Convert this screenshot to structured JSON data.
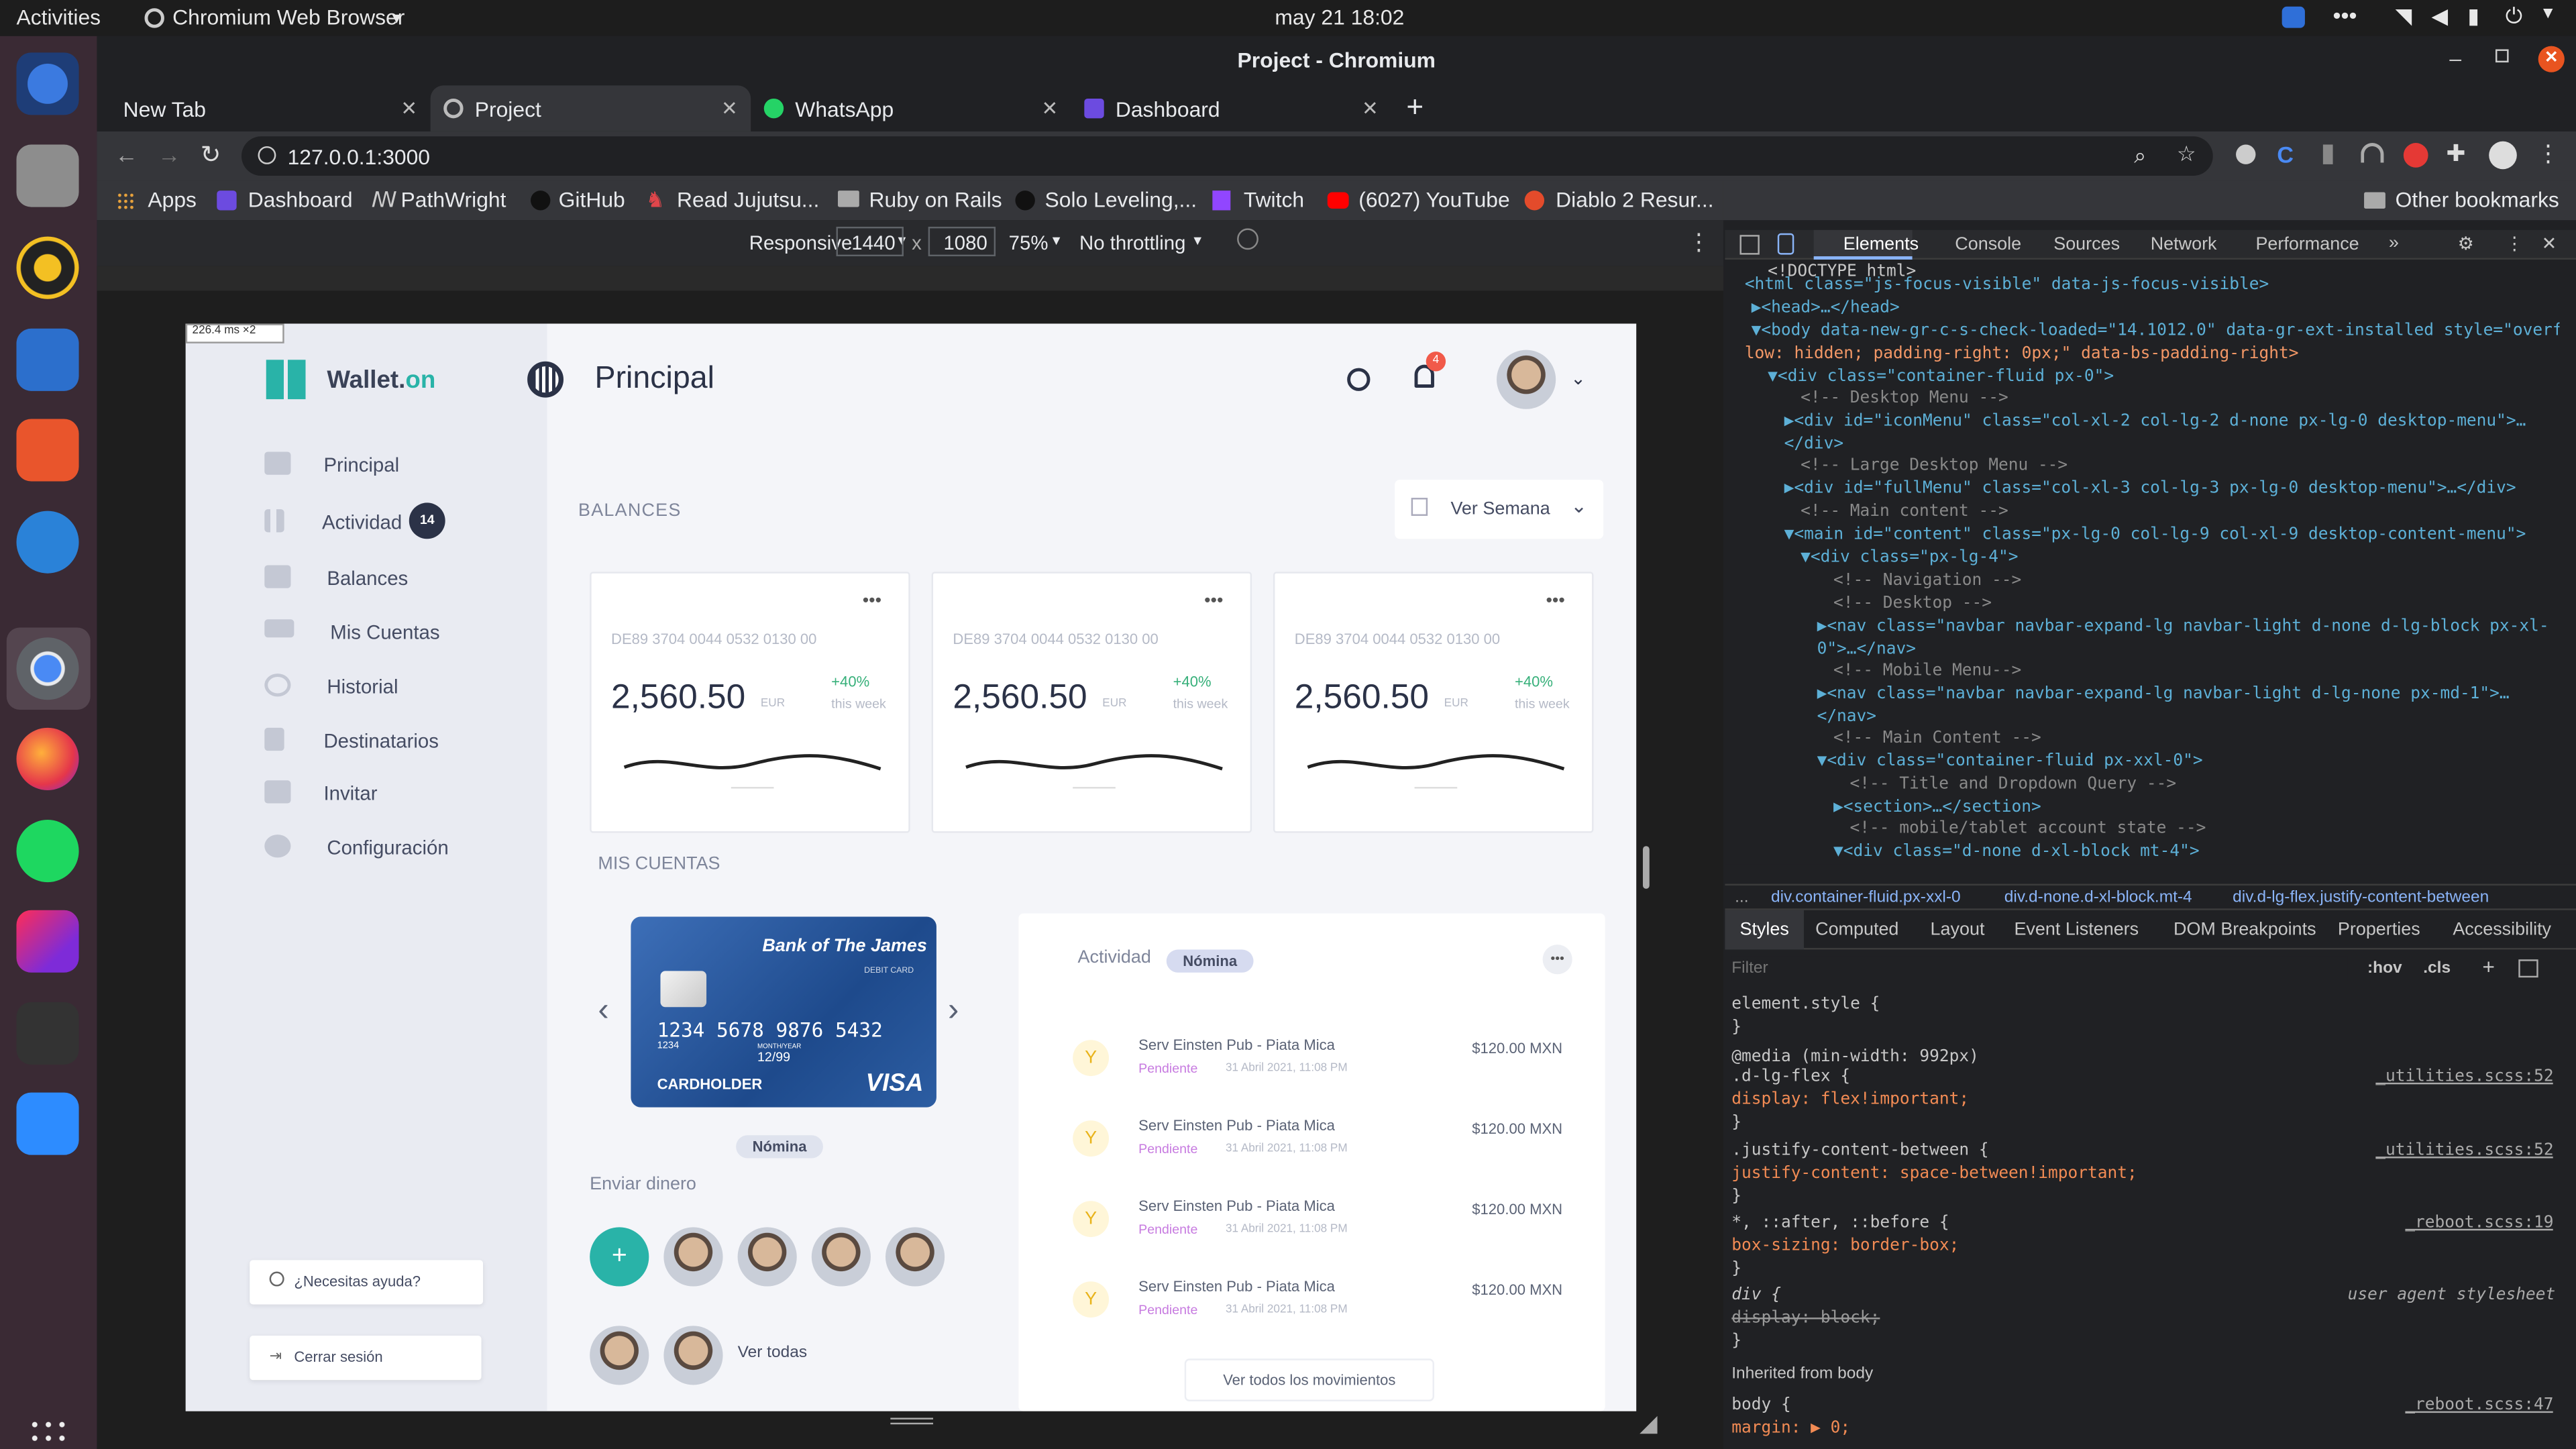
{
  "system": {
    "activities": "Activities",
    "app_menu": "Chromium Web Browser",
    "datetime": "may 21  18:02"
  },
  "window": {
    "title": "Project - Chromium"
  },
  "tabs": [
    {
      "label": "New Tab"
    },
    {
      "label": "Project"
    },
    {
      "label": "WhatsApp"
    },
    {
      "label": "Dashboard"
    }
  ],
  "address": "127.0.0.1:3000",
  "bookmarks": [
    {
      "label": "Apps"
    },
    {
      "label": "Dashboard"
    },
    {
      "label": "PathWright"
    },
    {
      "label": "GitHub"
    },
    {
      "label": "Read Jujutsu..."
    },
    {
      "label": "Ruby on Rails"
    },
    {
      "label": "Solo Leveling,..."
    },
    {
      "label": "Twitch"
    },
    {
      "label": "(6027) YouTube"
    },
    {
      "label": "Diablo 2 Resur..."
    }
  ],
  "other_bookmarks": "Other bookmarks",
  "device_toolbar": {
    "mode": "Responsive",
    "width": "1440",
    "times": "x",
    "height": "1080",
    "zoom": "75%",
    "throttling": "No throttling",
    "ms_badge": "226.4 ms ×2"
  },
  "app": {
    "brand_prefix": "Wallet.",
    "brand_suffix": "on",
    "page_title": "Principal",
    "notifications_count": "4",
    "nav": [
      {
        "label": "Principal"
      },
      {
        "label": "Actividad",
        "badge": "14"
      },
      {
        "label": "Balances"
      },
      {
        "label": "Mis Cuentas"
      },
      {
        "label": "Historial"
      },
      {
        "label": "Destinatarios"
      },
      {
        "label": "Invitar"
      },
      {
        "label": "Configuración"
      }
    ],
    "help": "¿Necesitas ayuda?",
    "logout": "Cerrar sesión",
    "balances_heading": "BALANCES",
    "period_select": "Ver Semana",
    "balance_cards": [
      {
        "iban": "DE89 3704 0044 0532 0130 00",
        "amount": "2,560.50",
        "currency": "EUR",
        "change": "+40%",
        "period": "this week"
      },
      {
        "iban": "DE89 3704 0044 0532 0130 00",
        "amount": "2,560.50",
        "currency": "EUR",
        "change": "+40%",
        "period": "this week"
      },
      {
        "iban": "DE89 3704 0044 0532 0130 00",
        "amount": "2,560.50",
        "currency": "EUR",
        "change": "+40%",
        "period": "this week"
      }
    ],
    "accounts_heading": "MIS CUENTAS",
    "bank_card": {
      "bank": "Bank of The James",
      "type": "DEBIT CARD",
      "number": "1234  5678  9876  5432",
      "small_number": "1234",
      "valid_label": "MONTH/YEAR",
      "valid": "12/99",
      "holder": "CARDHOLDER",
      "brand": "VISA",
      "label": "Nómina"
    },
    "send_money": "Enviar dinero",
    "see_all": "Ver todas",
    "activity": {
      "title": "Actividad",
      "tag": "Nómina",
      "items": [
        {
          "name": "Serv Einsten Pub - Piata Mica",
          "status": "Pendiente",
          "date": "31 Abril 2021, 11:08 PM",
          "amount": "$120.00 MXN"
        },
        {
          "name": "Serv Einsten Pub - Piata Mica",
          "status": "Pendiente",
          "date": "31 Abril 2021, 11:08 PM",
          "amount": "$120.00 MXN"
        },
        {
          "name": "Serv Einsten Pub - Piata Mica",
          "status": "Pendiente",
          "date": "31 Abril 2021, 11:08 PM",
          "amount": "$120.00 MXN"
        },
        {
          "name": "Serv Einsten Pub - Piata Mica",
          "status": "Pendiente",
          "date": "31 Abril 2021, 11:08 PM",
          "amount": "$120.00 MXN"
        }
      ],
      "see_all": "Ver todos los movimientos"
    }
  },
  "devtools": {
    "tabs": [
      "Elements",
      "Console",
      "Sources",
      "Network",
      "Performance"
    ],
    "dom_lines": [
      "<!DOCTYPE html>",
      "<html class=\"js-focus-visible\" data-js-focus-visible>",
      "▶<head>…</head>",
      "▼<body data-new-gr-c-s-check-loaded=\"14.1012.0\" data-gr-ext-installed style=\"overf",
      "low: hidden; padding-right: 0px;\" data-bs-padding-right>",
      "▼<div class=\"container-fluid px-0\">",
      "<!-- Desktop Menu -->",
      "▶<div id=\"iconMenu\" class=\"col-xl-2 col-lg-2 d-none px-lg-0 desktop-menu\">…",
      "</div>",
      "<!-- Large Desktop Menu -->",
      "▶<div id=\"fullMenu\" class=\"col-xl-3 col-lg-3 px-lg-0 desktop-menu\">…</div>",
      "<!-- Main content -->",
      "▼<main id=\"content\" class=\"px-lg-0 col-lg-9 col-xl-9 desktop-content-menu\">",
      "▼<div class=\"px-lg-4\">",
      "<!-- Navigation -->",
      "<!-- Desktop -->",
      "▶<nav class=\"navbar navbar-expand-lg navbar-light d-none d-lg-block px-xl-",
      "0\">…</nav>",
      "<!-- Mobile Menu-->",
      "▶<nav class=\"navbar navbar-expand-lg navbar-light d-lg-none px-md-1\">…",
      "</nav>",
      "<!-- Main Content -->",
      "▼<div class=\"container-fluid px-xxl-0\">",
      "<!-- Title and Dropdown Query -->",
      "▶<section>…</section>",
      "<!-- mobile/tablet account state -->",
      "▼<div class=\"d-none d-xl-block mt-4\">"
    ],
    "breadcrumbs": [
      "div.container-fluid.px-xxl-0",
      "div.d-none.d-xl-block.mt-4",
      "div.d-lg-flex.justify-content-between"
    ],
    "style_tabs": [
      "Styles",
      "Computed",
      "Layout",
      "Event Listeners",
      "DOM Breakpoints",
      "Properties",
      "Accessibility"
    ],
    "filter_placeholder": "Filter",
    "hov": ":hov",
    "cls": ".cls",
    "rules": [
      {
        "text": "element.style {",
        "source": ""
      },
      {
        "text": "}",
        "source": ""
      },
      {
        "text": "@media (min-width: 992px)",
        "source": ""
      },
      {
        "text": ".d-lg-flex {",
        "source": "_utilities.scss:52"
      },
      {
        "text": "  display: flex!important;",
        "source": ""
      },
      {
        "text": "}",
        "source": ""
      },
      {
        "text": ".justify-content-between {",
        "source": "_utilities.scss:52"
      },
      {
        "text": "  justify-content: space-between!important;",
        "source": ""
      },
      {
        "text": "}",
        "source": ""
      },
      {
        "text": "*, ::after, ::before {",
        "source": "_reboot.scss:19"
      },
      {
        "text": "  box-sizing: border-box;",
        "source": ""
      },
      {
        "text": "}",
        "source": ""
      },
      {
        "text": "div {",
        "source": "user agent stylesheet"
      },
      {
        "text": "  display: block;",
        "source": ""
      },
      {
        "text": "}",
        "source": ""
      },
      {
        "text": "Inherited from body",
        "source": ""
      },
      {
        "text": "body {",
        "source": "_reboot.scss:47"
      },
      {
        "text": "  margin: ▶ 0;",
        "source": ""
      }
    ]
  }
}
